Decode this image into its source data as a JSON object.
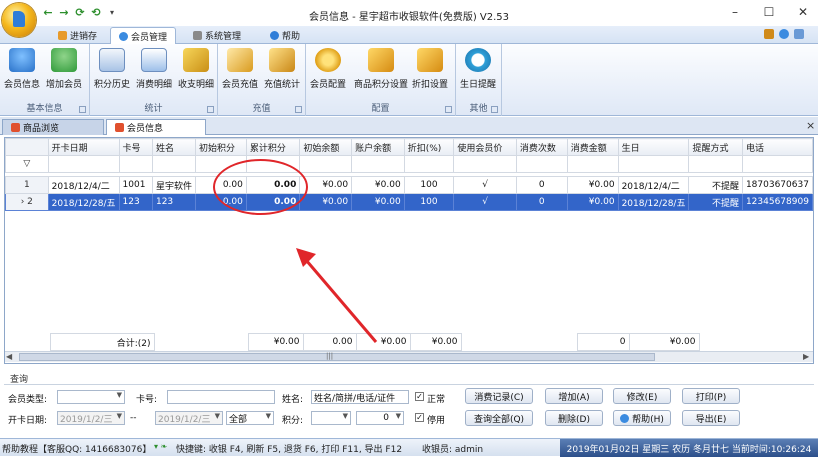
{
  "window": {
    "title": "会员信息 - 星宇超市收银软件(免费版) V2.53",
    "controls": {
      "minimize": "–",
      "maximize": "☐",
      "close": "✕"
    }
  },
  "quick_access": {
    "items": [
      "←",
      "→",
      "⟳",
      "⟲",
      "▾"
    ]
  },
  "ribbon_tabs": [
    {
      "label": "进销存",
      "icon": "box-icon"
    },
    {
      "label": "会员管理",
      "icon": "members-icon",
      "active": true
    },
    {
      "label": "系统管理",
      "icon": "wrench-icon"
    },
    {
      "label": "帮助",
      "icon": "help-icon"
    }
  ],
  "ribbon_groups": [
    {
      "label": "基本信息",
      "buttons": [
        {
          "label": "会员信息",
          "icon": "members-icon"
        },
        {
          "label": "增加会员",
          "icon": "add-member-icon"
        }
      ]
    },
    {
      "label": "统计",
      "buttons": [
        {
          "label": "积分历史",
          "icon": "history-icon"
        },
        {
          "label": "消费明细",
          "icon": "detail-icon"
        },
        {
          "label": "收支明细",
          "icon": "ledger-icon"
        }
      ]
    },
    {
      "label": "充值",
      "buttons": [
        {
          "label": "会员充值",
          "icon": "recharge-icon"
        },
        {
          "label": "充值统计",
          "icon": "recharge-stats-icon"
        }
      ]
    },
    {
      "label": "配置",
      "buttons": [
        {
          "label": "会员配置",
          "icon": "gear-icon"
        },
        {
          "label": "商品积分设置",
          "icon": "points-settings-icon"
        },
        {
          "label": "折扣设置",
          "icon": "discount-icon"
        }
      ]
    },
    {
      "label": "其他",
      "buttons": [
        {
          "label": "生日提醒",
          "icon": "alarm-clock-icon"
        }
      ]
    }
  ],
  "doc_tabs": [
    {
      "label": "商品浏览",
      "active": false
    },
    {
      "label": "会员信息",
      "active": true
    }
  ],
  "doc_close": "×",
  "grid": {
    "columns": [
      "开卡日期",
      "卡号",
      "姓名",
      "初始积分",
      "累计积分",
      "初始余额",
      "账户余额",
      "折扣(%)",
      "使用会员价",
      "消费次数",
      "消费金额",
      "生日",
      "提醒方式",
      "电话"
    ],
    "filter_icon": "▽",
    "rows": [
      {
        "num": "1",
        "indicator": "",
        "cells": [
          "2018/12/4/二",
          "1001",
          "星宇软件",
          "0.00",
          "0.00",
          "¥0.00",
          "¥0.00",
          "100",
          "√",
          "0",
          "¥0.00",
          "2018/12/4/二",
          "不提醒",
          "18703670637"
        ]
      },
      {
        "num": "2",
        "indicator": "›",
        "cells": [
          "2018/12/28/五",
          "123",
          "123",
          "0.00",
          "0.00",
          "¥0.00",
          "¥0.00",
          "100",
          "√",
          "0",
          "¥0.00",
          "2018/12/28/五",
          "不提醒",
          "12345678909"
        ]
      }
    ],
    "summary": {
      "count": "合计:(2)",
      "init_points": "¥0.00",
      "total_points": "0.00",
      "init_balance": "¥0.00",
      "balance": "¥0.00",
      "consume_count": "0",
      "consume_amount": "¥0.00"
    },
    "scroll_marker": "|||"
  },
  "query": {
    "title": "查询",
    "member_type_label": "会员类型:",
    "card_label": "卡号:",
    "name_label": "姓名:",
    "name_placeholder": "姓名/简拼/电话/证件",
    "normal_label": "正常",
    "disabled_label": "停用",
    "open_date_label": "开卡日期:",
    "date_from": "2019/1/2/三",
    "date_sep": "-- ",
    "date_to": "2019/1/2/三",
    "range_value": "全部",
    "points_label": "积分:",
    "points_value": "0",
    "buttons": {
      "consume_records": "消费记录(C)",
      "add": "增加(A)",
      "edit": "修改(E)",
      "print": "打印(P)",
      "query_all": "查询全部(Q)",
      "delete": "删除(D)",
      "help": "帮助(H)",
      "export": "导出(E)"
    }
  },
  "statusbar": {
    "help": "帮助教程【客服QQ: 1416683076】",
    "shortcuts": "快捷键: 收银 F4, 刷新 F5, 退货 F6, 打印 F11, 导出 F12",
    "cashier": "收银员: admin",
    "datetime": "2019年01月02日 星期三 农历 冬月廿七 当前时间:10:26:24"
  },
  "colors": {
    "selection": "#3365c9",
    "annotation": "#e0262a",
    "ribbon_bg": "#dfe8f6"
  }
}
